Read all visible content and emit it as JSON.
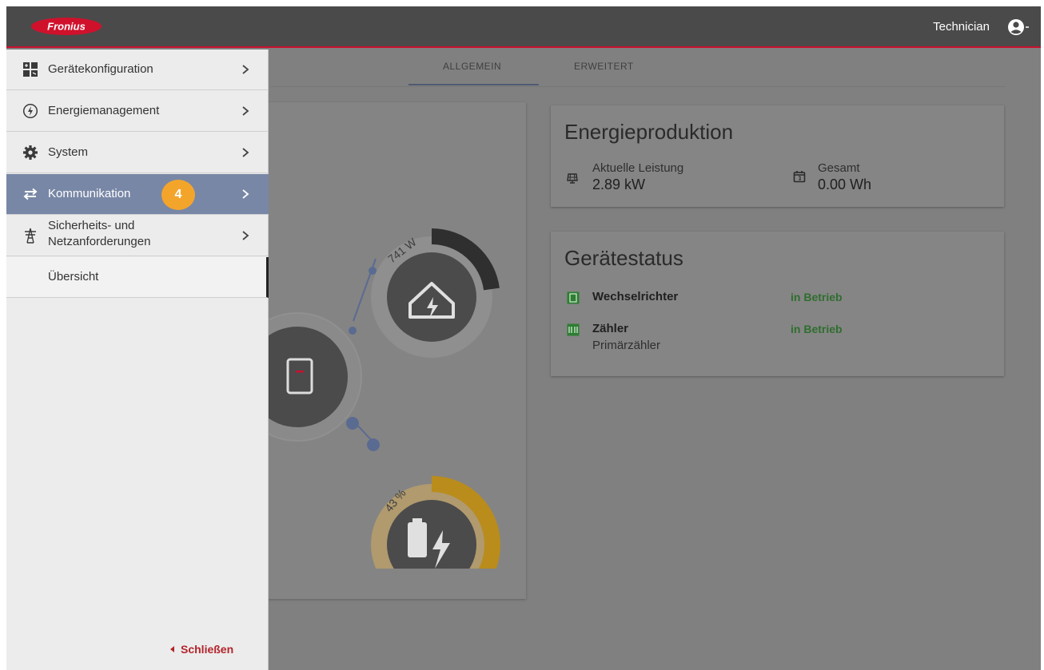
{
  "header": {
    "logo_text": "Fronius",
    "user_name": "Technician",
    "user_icon": "account-circle-icon"
  },
  "tabs": [
    {
      "label": "ALLGEMEIN",
      "active": true
    },
    {
      "label": "ERWEITERT",
      "active": false
    }
  ],
  "flow": {
    "house_power": "741 W",
    "battery_soc": "43 %"
  },
  "energy": {
    "title": "Energieproduktion",
    "current_label": "Aktuelle Leistung",
    "current_value": "2.89 kW",
    "total_label": "Gesamt",
    "total_value": "0.00 Wh"
  },
  "status": {
    "title": "Gerätestatus",
    "devices": [
      {
        "name": "Wechselrichter",
        "state": "in Betrieb",
        "sub": ""
      },
      {
        "name": "Zähler",
        "state": "in Betrieb",
        "sub": "Primärzähler"
      }
    ]
  },
  "sidebar": {
    "items": [
      {
        "label": "Gerätekonfiguration",
        "icon": "device-config-icon"
      },
      {
        "label": "Energiemanagement",
        "icon": "energy-icon"
      },
      {
        "label": "System",
        "icon": "gear-icon"
      },
      {
        "label": "Kommunikation",
        "icon": "swap-arrows-icon",
        "badge": "4",
        "active": true
      },
      {
        "label_line1": "Sicherheits- und",
        "label_line2": "Netzanforderungen",
        "icon": "power-tower-icon"
      },
      {
        "label": "Übersicht"
      }
    ],
    "close_label": "Schließen"
  },
  "colors": {
    "brand_red": "#c8102e",
    "active_item": "#7887a6",
    "badge": "#f3a52b",
    "status_ok": "#2f6e2f",
    "battery": "#c99a2c"
  }
}
